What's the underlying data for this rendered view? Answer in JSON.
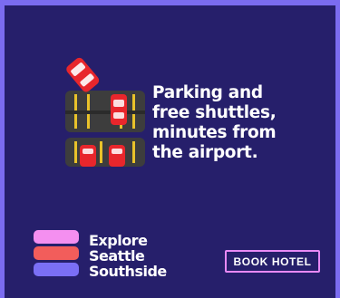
{
  "ad": {
    "headline_lines": [
      "Parking and",
      "free shuttles,",
      "minutes from",
      "the airport."
    ],
    "brand_lines": [
      "Explore",
      "Seattle",
      "Southside"
    ],
    "cta_label": "BOOK HOTEL",
    "colors": {
      "frame": "#7b6cf0",
      "background": "#261f6b",
      "pavement": "#3d3d3d",
      "stripe": "#e9c22a",
      "car": "#e8262c",
      "logo_pink": "#f48ff0",
      "logo_coral": "#f25d5b",
      "logo_violet": "#7b6ff5",
      "cta_border": "#e889f5"
    },
    "icons": [
      "parking-lot-illustration",
      "car-icon",
      "brand-logo-icon"
    ]
  }
}
